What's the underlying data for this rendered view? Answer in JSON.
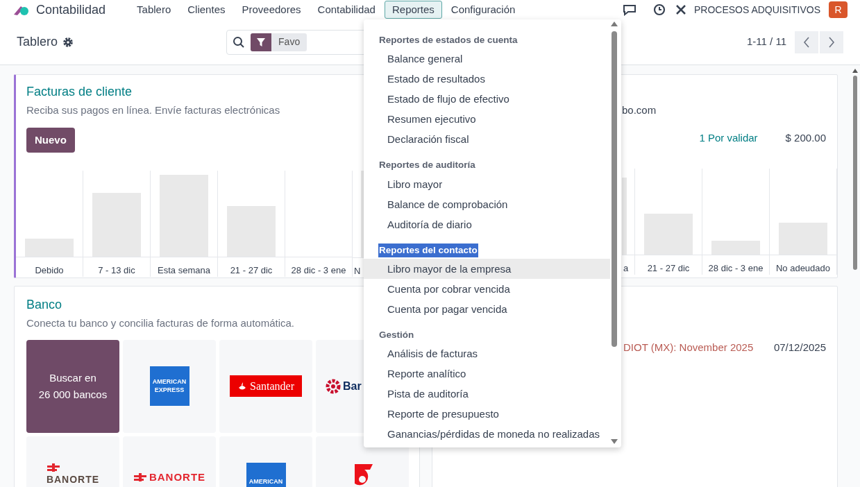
{
  "navbar": {
    "app_name": "Contabilidad",
    "menus": [
      {
        "label": "Tablero",
        "selected": false
      },
      {
        "label": "Clientes",
        "selected": false
      },
      {
        "label": "Proveedores",
        "selected": false
      },
      {
        "label": "Contabilidad",
        "selected": false
      },
      {
        "label": "Reportes",
        "selected": true
      },
      {
        "label": "Configuración",
        "selected": false
      }
    ],
    "company": "PROCESOS ADQUISITIVOS",
    "avatar_initial": "R"
  },
  "control_panel": {
    "title": "Tablero",
    "search_facet": "Favo",
    "pager": "1-11 / 11"
  },
  "cards": [
    {
      "kind": "invoices",
      "title": "Facturas de cliente",
      "subtitle": "Reciba sus pagos en línea. Envíe facturas electrónicas",
      "button": "Nuevo",
      "chart_labels": [
        "Debido",
        "7 - 13 dic",
        "Esta semana",
        "21 - 27 dic",
        "28 dic - 3 ene",
        "N"
      ]
    },
    {
      "kind": "partial_summary",
      "text": "bo.com",
      "pending": "1 Por validar",
      "amount": "$ 200.00",
      "chart_labels": [
        "a",
        "21 - 27 dic",
        "28 dic - 3 ene",
        "No adeudado"
      ]
    },
    {
      "kind": "bank",
      "title": "Banco",
      "subtitle": "Conecta tu banco y concilia facturas de forma automática.",
      "tiles": [
        {
          "kind": "search",
          "lines": [
            "Buscar en",
            "26 000 bancos"
          ]
        },
        {
          "kind": "amex",
          "lines": [
            "AMERICAN",
            "EXPRESS"
          ]
        },
        {
          "kind": "santander",
          "lines": [
            "Santander"
          ]
        },
        {
          "kind": "banamex",
          "lines": [
            "Bar"
          ]
        },
        {
          "kind": "banorte_stacked",
          "lines": [
            "BANORTE"
          ]
        },
        {
          "kind": "banorte",
          "lines": [
            "BANORTE"
          ]
        },
        {
          "kind": "amex",
          "lines": [
            "AMERICAN"
          ]
        },
        {
          "kind": "scotiabank"
        }
      ]
    },
    {
      "kind": "deadline",
      "text": "DIOT (MX): November 2025",
      "date": "07/12/2025"
    }
  ],
  "reports_menu": {
    "sections": [
      {
        "header": "Reportes de estados de cuenta",
        "highlighted": false,
        "items": [
          {
            "label": "Balance general",
            "hovered": false
          },
          {
            "label": "Estado de resultados",
            "hovered": false
          },
          {
            "label": "Estado de flujo de efectivo",
            "hovered": false
          },
          {
            "label": "Resumen ejecutivo",
            "hovered": false
          },
          {
            "label": "Declaración fiscal",
            "hovered": false
          }
        ]
      },
      {
        "header": "Reportes de auditoría",
        "highlighted": false,
        "items": [
          {
            "label": "Libro mayor",
            "hovered": false
          },
          {
            "label": "Balance de comprobación",
            "hovered": false
          },
          {
            "label": "Auditoría de diario",
            "hovered": false
          }
        ]
      },
      {
        "header": "Reportes del contacto",
        "highlighted": true,
        "items": [
          {
            "label": "Libro mayor de la empresa",
            "hovered": true
          },
          {
            "label": "Cuenta por cobrar vencida",
            "hovered": false
          },
          {
            "label": "Cuenta por pagar vencida",
            "hovered": false
          }
        ]
      },
      {
        "header": "Gestión",
        "highlighted": false,
        "items": [
          {
            "label": "Análisis de facturas",
            "hovered": false
          },
          {
            "label": "Reporte analítico",
            "hovered": false
          },
          {
            "label": "Pista de auditoría",
            "hovered": false
          },
          {
            "label": "Reporte de presupuesto",
            "hovered": false
          },
          {
            "label": "Ganancias/pérdidas de moneda no realizadas",
            "hovered": false
          }
        ]
      }
    ]
  }
}
